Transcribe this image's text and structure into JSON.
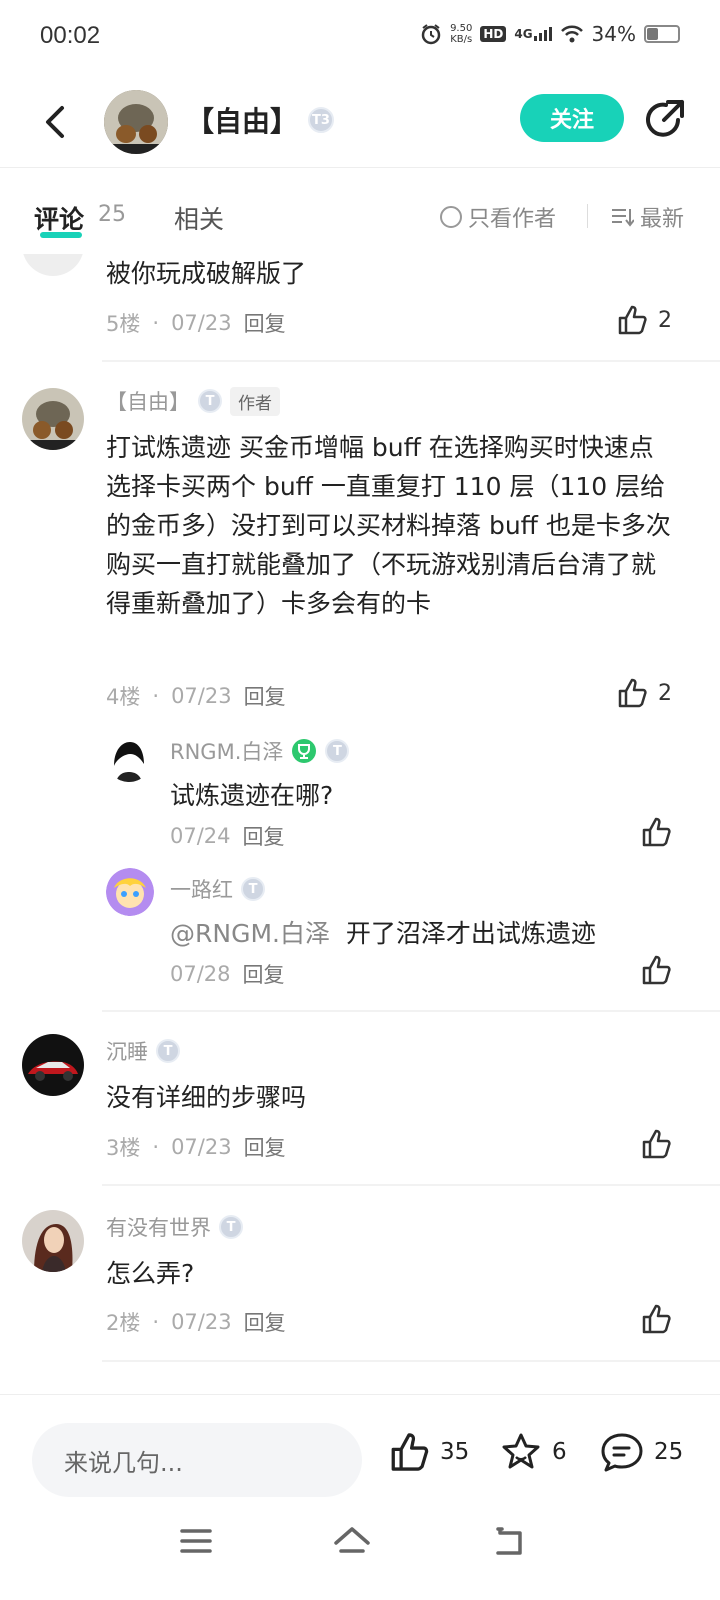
{
  "status": {
    "time": "00:02",
    "speed_value": "9.50",
    "speed_unit": "KB/s",
    "hd": "HD",
    "network": "4G",
    "battery": "34%",
    "battery_level": 0.34
  },
  "header": {
    "title": "【自由】",
    "level": "T3",
    "follow_label": "关注"
  },
  "tabs": {
    "comments_label": "评论",
    "comments_count": "25",
    "related_label": "相关",
    "only_author_label": "只看作者",
    "sort_label": "最新"
  },
  "comments": [
    {
      "body": "被你玩成破解版了",
      "floor": "5楼",
      "date": "07/23",
      "reply": "回复",
      "likes": "2"
    },
    {
      "user": "【自由】",
      "badge": "作者",
      "body": "打试炼遗迹  买金币增幅 buff  在选择购买时快速点选择卡买两个 buff 一直重复打 110 层（110 层给的金币多）没打到可以买材料掉落 buff 也是卡多次购买一直打就能叠加了（不玩游戏别清后台清了就得重新叠加了）卡多会有的卡",
      "floor": "4楼",
      "date": "07/23",
      "reply": "回复",
      "likes": "2",
      "replies": [
        {
          "user": "RNGM.白泽",
          "body": "试炼遗迹在哪?",
          "date": "07/24",
          "reply": "回复"
        },
        {
          "user": "一路红",
          "mention": "@RNGM.白泽",
          "body": "开了沼泽才出试炼遗迹",
          "date": "07/28",
          "reply": "回复"
        }
      ]
    },
    {
      "user": "沉睡",
      "body": "没有详细的步骤吗",
      "floor": "3楼",
      "date": "07/23",
      "reply": "回复"
    },
    {
      "user": "有没有世界",
      "body": "怎么弄?",
      "floor": "2楼",
      "date": "07/23",
      "reply": "回复"
    }
  ],
  "bottom": {
    "input_placeholder": "来说几句...",
    "likes": "35",
    "stars": "6",
    "comments": "25"
  },
  "colors": {
    "accent": "#18d2b8"
  }
}
